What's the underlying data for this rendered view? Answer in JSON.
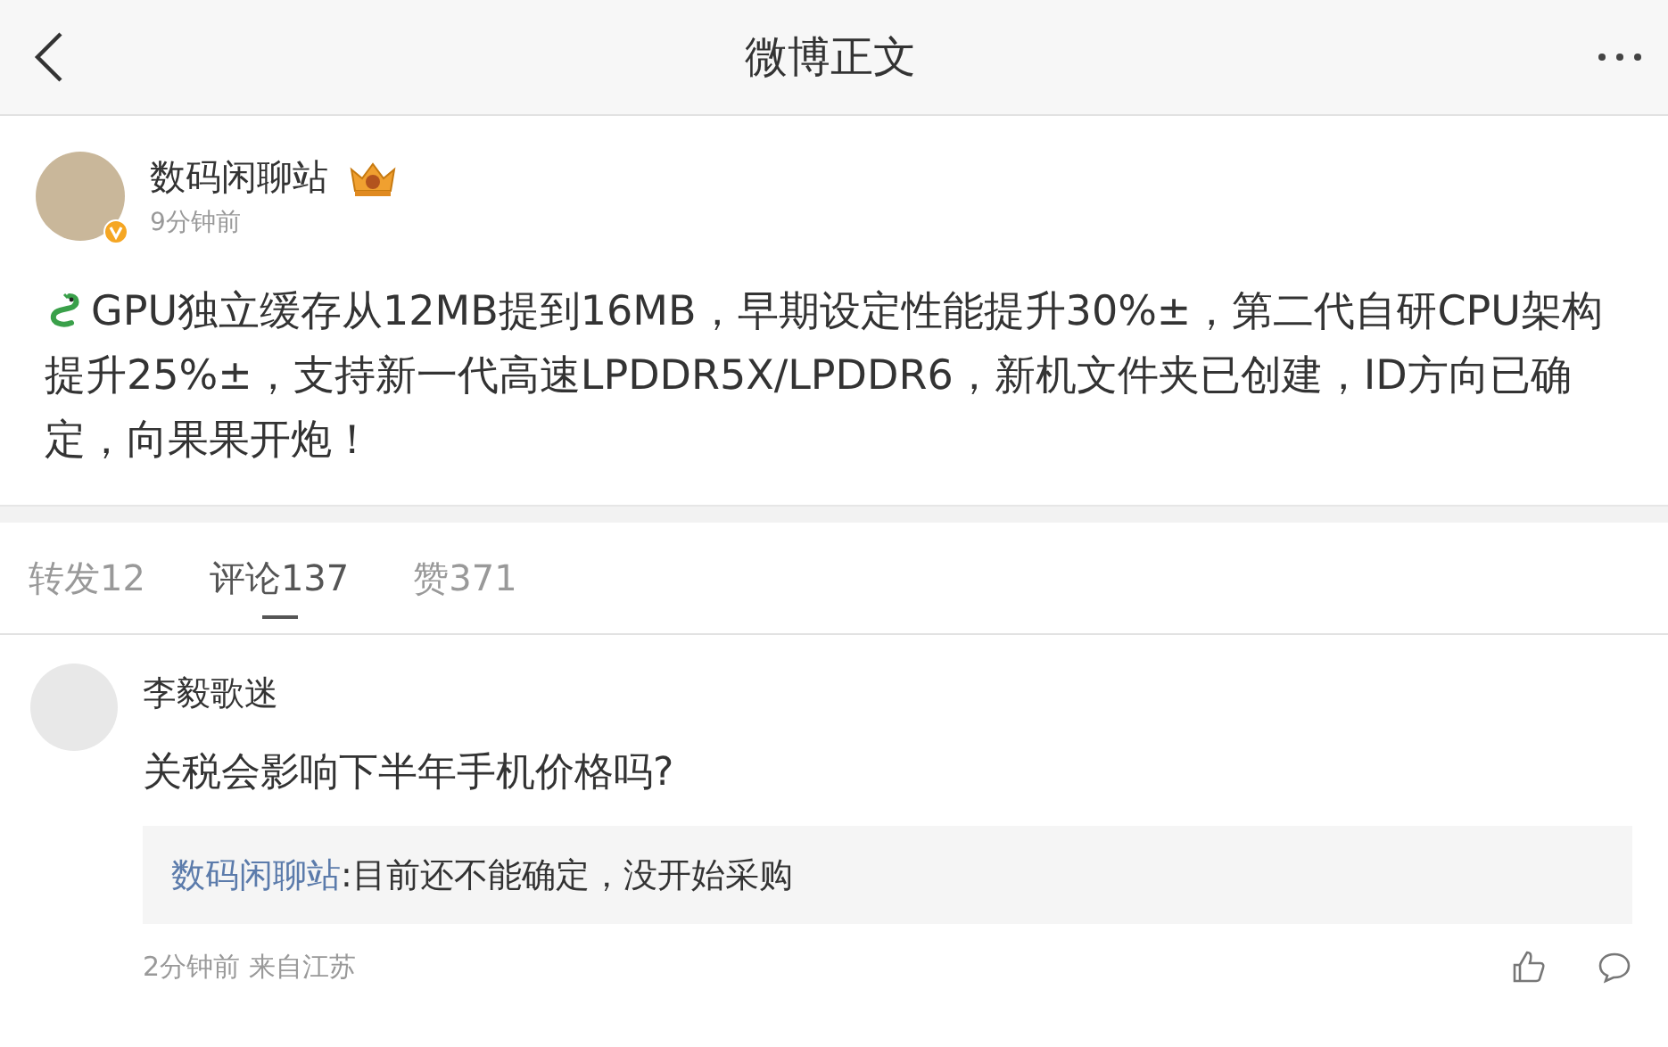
{
  "header": {
    "title": "微博正文"
  },
  "post": {
    "author": "数码闲聊站",
    "time": "9分钟前",
    "text": "GPU独立缓存从12MB提到16MB，早期设定性能提升30%±，第二代自研CPU架构提升25%±，支持新一代高速LPDDR5X/LPDDR6，新机文件夹已创建，ID方向已确定，向果果开炮！"
  },
  "tabs": [
    {
      "label": "转发12",
      "selected": false
    },
    {
      "label": "评论137",
      "selected": true
    },
    {
      "label": "赞371",
      "selected": false
    }
  ],
  "comments": [
    {
      "author": "李毅歌迷",
      "text": "关税会影响下半年手机价格吗?",
      "reply": {
        "author": "数码闲聊站",
        "text": ":目前还不能确定，没开始采购"
      },
      "meta": "2分钟前 来自江苏"
    }
  ]
}
